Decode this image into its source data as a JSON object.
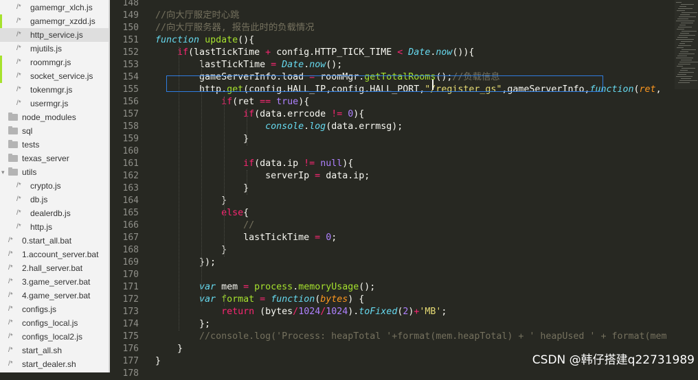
{
  "sidebar": {
    "items": [
      {
        "label": "gamemgr_xlch.js",
        "kind": "file",
        "indent": 1
      },
      {
        "label": "gamemgr_xzdd.js",
        "kind": "file",
        "indent": 1,
        "dirty": true
      },
      {
        "label": "http_service.js",
        "kind": "file",
        "indent": 1,
        "active": true
      },
      {
        "label": "mjutils.js",
        "kind": "file",
        "indent": 1
      },
      {
        "label": "roommgr.js",
        "kind": "file",
        "indent": 1,
        "dirty": true
      },
      {
        "label": "socket_service.js",
        "kind": "file",
        "indent": 1,
        "dirty": true
      },
      {
        "label": "tokenmgr.js",
        "kind": "file",
        "indent": 1
      },
      {
        "label": "usermgr.js",
        "kind": "file",
        "indent": 1
      },
      {
        "label": "node_modules",
        "kind": "folder",
        "indent": 0
      },
      {
        "label": "sql",
        "kind": "folder",
        "indent": 0
      },
      {
        "label": "tests",
        "kind": "folder",
        "indent": 0
      },
      {
        "label": "texas_server",
        "kind": "folder",
        "indent": 0
      },
      {
        "label": "utils",
        "kind": "folder-open",
        "indent": 0
      },
      {
        "label": "crypto.js",
        "kind": "file",
        "indent": 1
      },
      {
        "label": "db.js",
        "kind": "file",
        "indent": 1
      },
      {
        "label": "dealerdb.js",
        "kind": "file",
        "indent": 1
      },
      {
        "label": "http.js",
        "kind": "file",
        "indent": 1
      },
      {
        "label": "0.start_all.bat",
        "kind": "file",
        "indent": 0
      },
      {
        "label": "1.account_server.bat",
        "kind": "file",
        "indent": 0
      },
      {
        "label": "2.hall_server.bat",
        "kind": "file",
        "indent": 0
      },
      {
        "label": "3.game_server.bat",
        "kind": "file",
        "indent": 0
      },
      {
        "label": "4.game_server.bat",
        "kind": "file",
        "indent": 0
      },
      {
        "label": "configs.js",
        "kind": "file",
        "indent": 0
      },
      {
        "label": "configs_local.js",
        "kind": "file",
        "indent": 0
      },
      {
        "label": "configs_local2.js",
        "kind": "file",
        "indent": 0
      },
      {
        "label": "start_all.sh",
        "kind": "file",
        "indent": 0
      },
      {
        "label": "start_dealer.sh",
        "kind": "file",
        "indent": 0
      }
    ]
  },
  "editor": {
    "lines": [
      {
        "num": "148",
        "tokens": []
      },
      {
        "num": "149",
        "tokens": [
          {
            "t": "//向大厅服定时心跳",
            "c": "c"
          }
        ]
      },
      {
        "num": "150",
        "tokens": [
          {
            "t": "//向大厅服务器, 报告此时的负载情况",
            "c": "c"
          }
        ]
      },
      {
        "num": "151",
        "tokens": [
          {
            "t": "function",
            "c": "v"
          },
          {
            "t": " "
          },
          {
            "t": "update",
            "c": "f"
          },
          {
            "t": "(){"
          }
        ]
      },
      {
        "num": "152",
        "tokens": [
          {
            "t": "    "
          },
          {
            "t": "if",
            "c": "k"
          },
          {
            "t": "(lastTickTime "
          },
          {
            "t": "+",
            "c": "k"
          },
          {
            "t": " config.HTTP_TICK_TIME "
          },
          {
            "t": "<",
            "c": "k"
          },
          {
            "t": " "
          },
          {
            "t": "Date",
            "c": "v"
          },
          {
            "t": "."
          },
          {
            "t": "now",
            "c": "v"
          },
          {
            "t": "()){"
          }
        ]
      },
      {
        "num": "153",
        "tokens": [
          {
            "t": "        lastTickTime "
          },
          {
            "t": "=",
            "c": "k"
          },
          {
            "t": " "
          },
          {
            "t": "Date",
            "c": "v"
          },
          {
            "t": "."
          },
          {
            "t": "now",
            "c": "v"
          },
          {
            "t": "();"
          }
        ]
      },
      {
        "num": "154",
        "tokens": [
          {
            "t": "        gameServerInfo.load "
          },
          {
            "t": "=",
            "c": "k"
          },
          {
            "t": " roomMgr."
          },
          {
            "t": "getTotalRooms",
            "c": "f"
          },
          {
            "t": "();"
          },
          {
            "t": "//负载信息",
            "c": "c"
          }
        ]
      },
      {
        "num": "155",
        "tokens": [
          {
            "t": "        http."
          },
          {
            "t": "get",
            "c": "f"
          },
          {
            "t": "(config.HALL_IP,config.HALL_PORT,"
          },
          {
            "t": "\"/register_gs\"",
            "c": "s"
          },
          {
            "t": ",gameServerInfo,"
          },
          {
            "t": "function",
            "c": "v"
          },
          {
            "t": "("
          },
          {
            "t": "ret",
            "c": "p"
          },
          {
            "t": ","
          }
        ]
      },
      {
        "num": "156",
        "tokens": [
          {
            "t": "            "
          },
          {
            "t": "if",
            "c": "k"
          },
          {
            "t": "(ret "
          },
          {
            "t": "==",
            "c": "k"
          },
          {
            "t": " "
          },
          {
            "t": "true",
            "c": "n"
          },
          {
            "t": "){"
          }
        ]
      },
      {
        "num": "157",
        "tokens": [
          {
            "t": "                "
          },
          {
            "t": "if",
            "c": "k"
          },
          {
            "t": "(data.errcode "
          },
          {
            "t": "!=",
            "c": "k"
          },
          {
            "t": " "
          },
          {
            "t": "0",
            "c": "n"
          },
          {
            "t": "){"
          }
        ]
      },
      {
        "num": "158",
        "tokens": [
          {
            "t": "                    "
          },
          {
            "t": "console",
            "c": "v"
          },
          {
            "t": "."
          },
          {
            "t": "log",
            "c": "v"
          },
          {
            "t": "(data.errmsg);"
          }
        ]
      },
      {
        "num": "159",
        "tokens": [
          {
            "t": "                }"
          }
        ]
      },
      {
        "num": "160",
        "tokens": []
      },
      {
        "num": "161",
        "tokens": [
          {
            "t": "                "
          },
          {
            "t": "if",
            "c": "k"
          },
          {
            "t": "(data.ip "
          },
          {
            "t": "!=",
            "c": "k"
          },
          {
            "t": " "
          },
          {
            "t": "null",
            "c": "n"
          },
          {
            "t": "){"
          }
        ]
      },
      {
        "num": "162",
        "tokens": [
          {
            "t": "                    serverIp "
          },
          {
            "t": "=",
            "c": "k"
          },
          {
            "t": " data.ip;"
          }
        ]
      },
      {
        "num": "163",
        "tokens": [
          {
            "t": "                }"
          }
        ]
      },
      {
        "num": "164",
        "tokens": [
          {
            "t": "            }"
          }
        ]
      },
      {
        "num": "165",
        "tokens": [
          {
            "t": "            "
          },
          {
            "t": "else",
            "c": "k"
          },
          {
            "t": "{"
          }
        ]
      },
      {
        "num": "166",
        "tokens": [
          {
            "t": "                "
          },
          {
            "t": "//",
            "c": "c"
          }
        ]
      },
      {
        "num": "167",
        "tokens": [
          {
            "t": "                lastTickTime "
          },
          {
            "t": "=",
            "c": "k"
          },
          {
            "t": " "
          },
          {
            "t": "0",
            "c": "n"
          },
          {
            "t": ";"
          }
        ]
      },
      {
        "num": "168",
        "tokens": [
          {
            "t": "            }"
          }
        ]
      },
      {
        "num": "169",
        "tokens": [
          {
            "t": "        });"
          }
        ]
      },
      {
        "num": "170",
        "tokens": []
      },
      {
        "num": "171",
        "tokens": [
          {
            "t": "        "
          },
          {
            "t": "var",
            "c": "v"
          },
          {
            "t": " mem "
          },
          {
            "t": "=",
            "c": "k"
          },
          {
            "t": " "
          },
          {
            "t": "process",
            "c": "f"
          },
          {
            "t": "."
          },
          {
            "t": "memoryUsage",
            "c": "f"
          },
          {
            "t": "();"
          }
        ]
      },
      {
        "num": "172",
        "tokens": [
          {
            "t": "        "
          },
          {
            "t": "var",
            "c": "v"
          },
          {
            "t": " "
          },
          {
            "t": "format",
            "c": "f"
          },
          {
            "t": " "
          },
          {
            "t": "=",
            "c": "k"
          },
          {
            "t": " "
          },
          {
            "t": "function",
            "c": "v"
          },
          {
            "t": "("
          },
          {
            "t": "bytes",
            "c": "p"
          },
          {
            "t": ") {"
          }
        ]
      },
      {
        "num": "173",
        "tokens": [
          {
            "t": "            "
          },
          {
            "t": "return",
            "c": "k"
          },
          {
            "t": " (bytes"
          },
          {
            "t": "/",
            "c": "k"
          },
          {
            "t": "1024",
            "c": "n"
          },
          {
            "t": "/",
            "c": "k"
          },
          {
            "t": "1024",
            "c": "n"
          },
          {
            "t": ")."
          },
          {
            "t": "toFixed",
            "c": "v"
          },
          {
            "t": "("
          },
          {
            "t": "2",
            "c": "n"
          },
          {
            "t": ")"
          },
          {
            "t": "+",
            "c": "k"
          },
          {
            "t": "'MB'",
            "c": "s"
          },
          {
            "t": ";"
          }
        ]
      },
      {
        "num": "174",
        "tokens": [
          {
            "t": "        };"
          }
        ]
      },
      {
        "num": "175",
        "tokens": [
          {
            "t": "        "
          },
          {
            "t": "//console.log('Process: heapTotal '+format(mem.heapTotal) + ' heapUsed ' + format(mem",
            "c": "c"
          }
        ]
      },
      {
        "num": "176",
        "tokens": [
          {
            "t": "    }"
          }
        ]
      },
      {
        "num": "177",
        "tokens": [
          {
            "t": "}"
          }
        ]
      },
      {
        "num": "178",
        "tokens": []
      }
    ]
  },
  "watermark": "CSDN @韩仔搭建q22731989"
}
